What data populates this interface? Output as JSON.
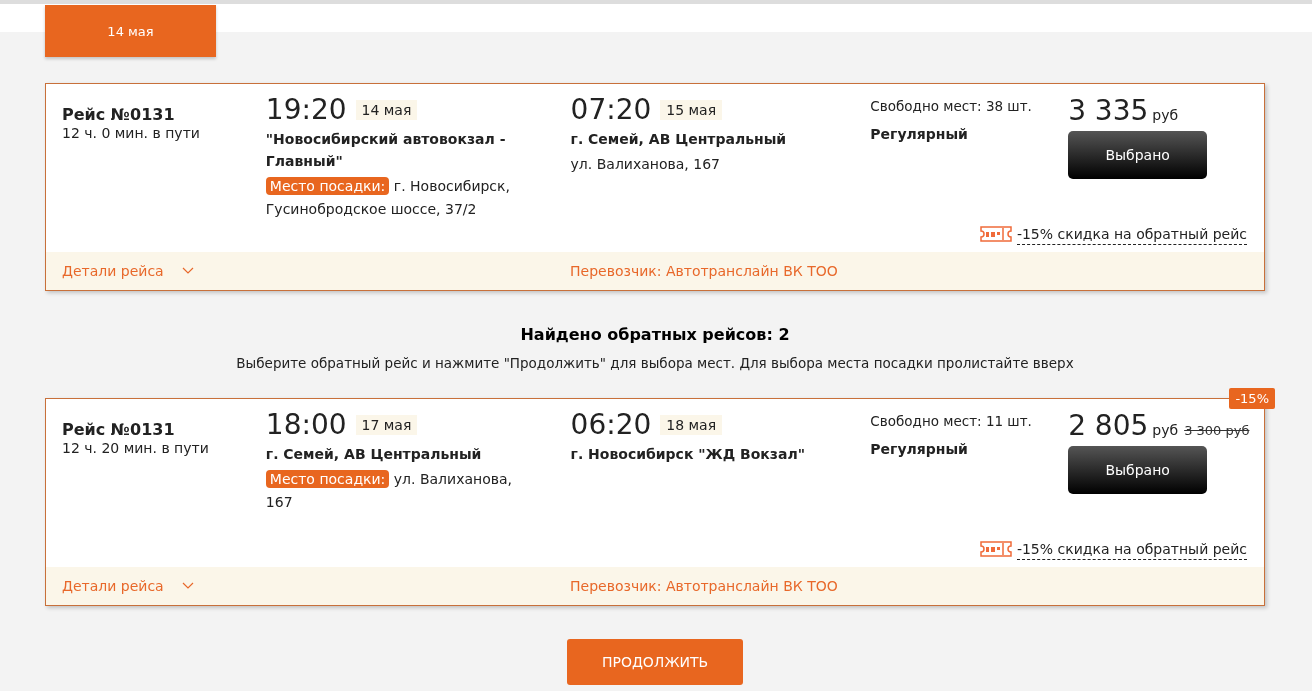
{
  "date_tabs": [
    {
      "label": "14 мая",
      "selected": true
    }
  ],
  "outbound": [
    {
      "trip": "Рейс №0131",
      "duration": "12 ч. 0 мин. в пути",
      "dep_time": "19:20",
      "dep_date": "14 мая",
      "dep_station": "\"Новосибирский автовокзал - Главный\"",
      "boarding_label": "Место посадки:",
      "boarding_address": "г. Новосибирск, Гусинобродское шоссе, 37/2",
      "arr_time": "07:20",
      "arr_date": "15 мая",
      "arr_station": "г. Семей, АВ Центральный",
      "arr_address": "ул. Валиханова, 167",
      "seats": "Свободно мест: 38 шт.",
      "type": "Регулярный",
      "price": "3 335",
      "currency": "руб",
      "button": "Выбрано",
      "discount_note": "-15% скидка на обратный рейс",
      "details": "Детали рейса",
      "carrier": "Перевозчик: Автотранслайн ВК ТОО"
    }
  ],
  "return_heading": "Найдено обратных рейсов: 2",
  "return_hint": "Выберите обратный рейс и нажмите \"Продолжить\" для выбора мест. Для выбора места посадки пролистайте вверх",
  "returns": [
    {
      "trip": "Рейс №0131",
      "duration": "12 ч. 20 мин. в пути",
      "dep_time": "18:00",
      "dep_date": "17 мая",
      "dep_station": "г. Семей, АВ Центральный",
      "boarding_label": "Место посадки:",
      "boarding_address": "ул. Валиханова, 167",
      "arr_time": "06:20",
      "arr_date": "18 мая",
      "arr_station": "г. Новосибирск \"ЖД Вокзал\"",
      "seats": "Свободно мест: 11 шт.",
      "type": "Регулярный",
      "price": "2 805",
      "currency": "руб",
      "old_price": "3 300 руб",
      "badge": "-15%",
      "button": "Выбрано",
      "discount_note": "-15% скидка на обратный рейс",
      "details": "Детали рейса",
      "carrier": "Перевозчик: Автотранслайн ВК ТОО"
    }
  ],
  "continue_button": "ПРОДОЛЖИТЬ"
}
